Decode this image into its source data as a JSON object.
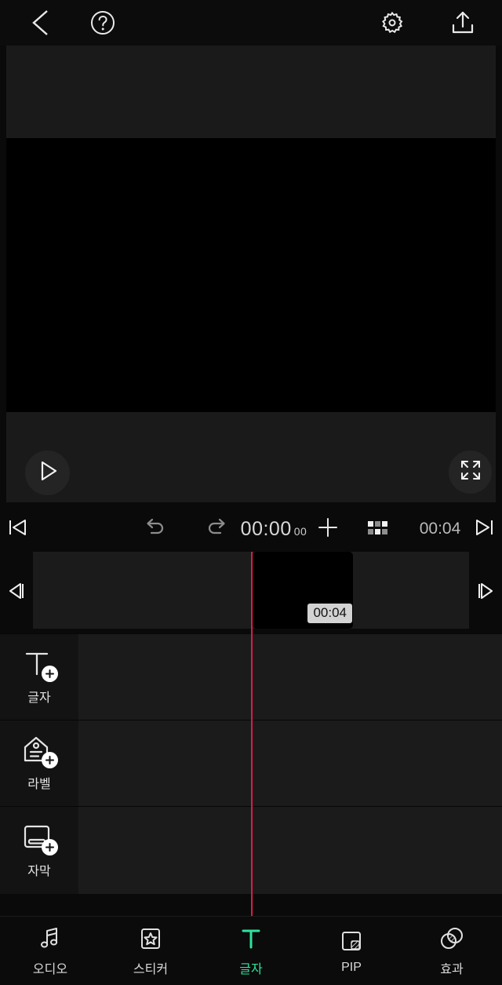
{
  "app": {
    "accent_green": "#2fe39c",
    "playhead_color": "#e0194a",
    "background": "#0a0a0a"
  },
  "topbar": {
    "back_icon": "chevron-left-icon",
    "help_icon": "question-circle-icon",
    "settings_icon": "gear-icon",
    "export_icon": "export-upload-icon"
  },
  "preview": {
    "play_icon": "play-triangle-icon",
    "fullscreen_icon": "expand-arrows-icon"
  },
  "timeline_controls": {
    "skip_start_icon": "skip-to-start-icon",
    "undo_icon": "undo-arrow-icon",
    "redo_icon": "redo-arrow-icon",
    "current_time": "00:00",
    "current_frames": "00",
    "add_icon": "plus-icon",
    "layers_icon": "grid-layers-icon",
    "total_duration": "00:04",
    "skip_end_icon": "skip-to-end-icon"
  },
  "timeline": {
    "step_back_icon": "step-back-frame-icon",
    "step_forward_icon": "step-forward-frame-icon",
    "clip_duration_badge": "00:04"
  },
  "tracks": [
    {
      "label": "글자",
      "icon": "text-add-icon"
    },
    {
      "label": "라벨",
      "icon": "label-tag-add-icon"
    },
    {
      "label": "자막",
      "icon": "subtitle-add-icon"
    }
  ],
  "bottom_nav": [
    {
      "label": "오디오",
      "icon": "music-note-icon",
      "active": false
    },
    {
      "label": "스티커",
      "icon": "sticker-star-icon",
      "active": false
    },
    {
      "label": "글자",
      "icon": "text-t-icon",
      "active": true
    },
    {
      "label": "PIP",
      "icon": "picture-in-picture-icon",
      "active": false
    },
    {
      "label": "효과",
      "icon": "effects-overlap-icon",
      "active": false
    }
  ]
}
